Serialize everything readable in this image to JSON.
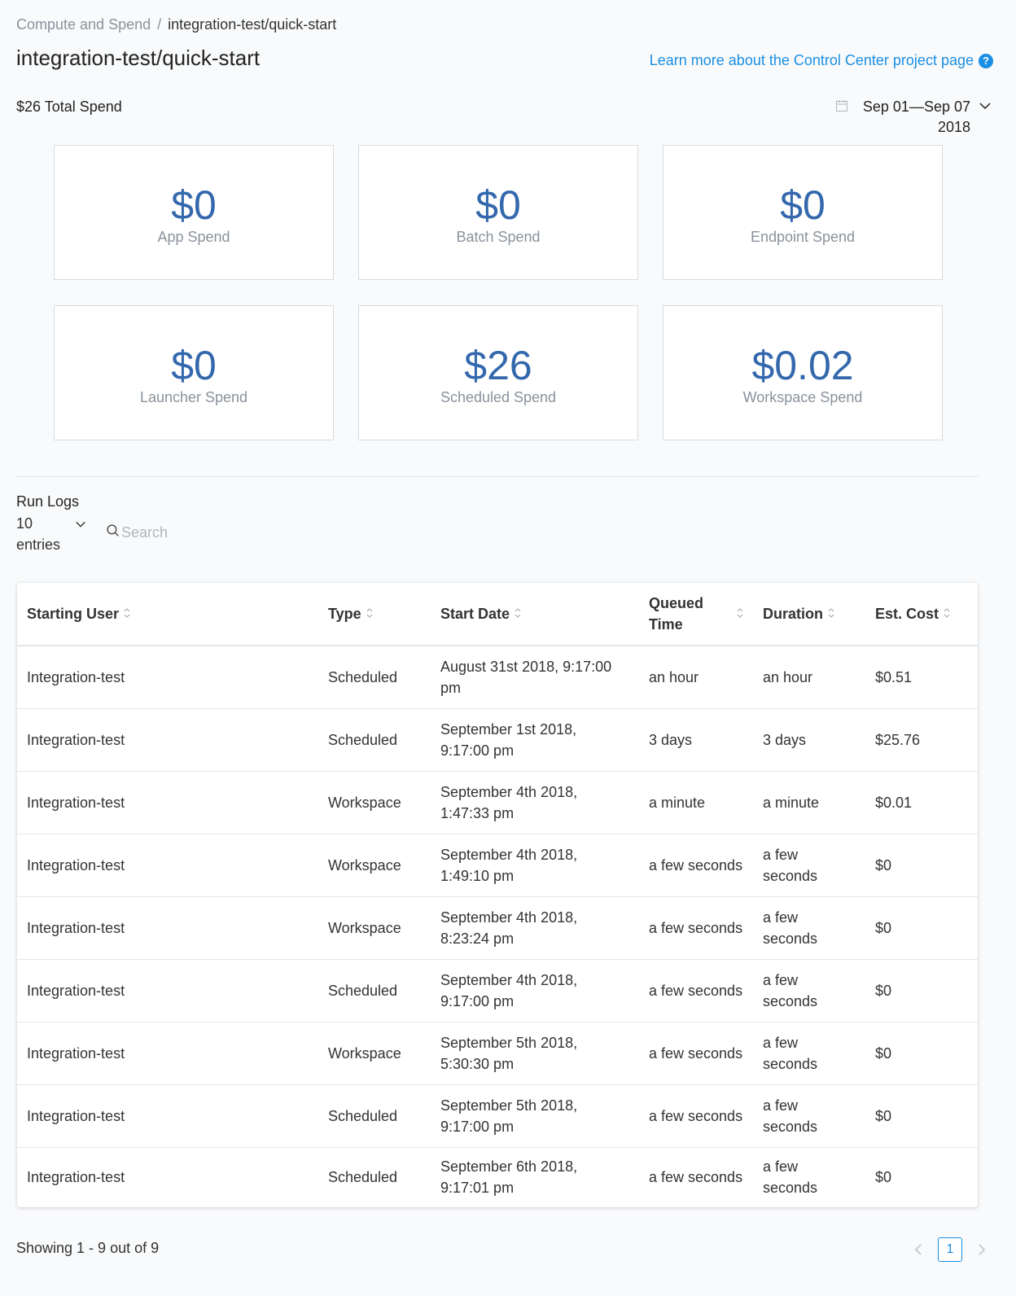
{
  "breadcrumb": {
    "parent": "Compute and Spend",
    "separator": "/",
    "current": "integration-test/quick-start"
  },
  "page_title": "integration-test/quick-start",
  "learn_more": {
    "label": "Learn more about the Control Center project page",
    "icon": "help-icon"
  },
  "total_spend": "$26 Total Spend",
  "date_range": {
    "line1": "Sep 01—Sep 07",
    "line2": "2018",
    "icon": "calendar-icon"
  },
  "cards": [
    {
      "value": "$0",
      "label": "App Spend"
    },
    {
      "value": "$0",
      "label": "Batch Spend"
    },
    {
      "value": "$0",
      "label": "Endpoint Spend"
    },
    {
      "value": "$0",
      "label": "Launcher Spend"
    },
    {
      "value": "$26",
      "label": "Scheduled Spend"
    },
    {
      "value": "$0.02",
      "label": "Workspace Spend"
    }
  ],
  "run_logs": {
    "title": "Run Logs",
    "entries_value": "10",
    "entries_label": "entries",
    "search_placeholder": "Search"
  },
  "table": {
    "headers": {
      "user": "Starting User",
      "type": "Type",
      "start": "Start Date",
      "queued": "Queued Time",
      "duration": "Duration",
      "cost": "Est. Cost"
    },
    "rows": [
      {
        "user": "Integration-test",
        "type": "Scheduled",
        "start": "August 31st 2018, 9:17:00 pm",
        "queued": "an hour",
        "duration": "an hour",
        "cost": "$0.51"
      },
      {
        "user": "Integration-test",
        "type": "Scheduled",
        "start": "September 1st 2018, 9:17:00 pm",
        "queued": "3 days",
        "duration": "3 days",
        "cost": "$25.76"
      },
      {
        "user": "Integration-test",
        "type": "Workspace",
        "start": "September 4th 2018, 1:47:33 pm",
        "queued": "a minute",
        "duration": "a minute",
        "cost": "$0.01"
      },
      {
        "user": "Integration-test",
        "type": "Workspace",
        "start": "September 4th 2018, 1:49:10 pm",
        "queued": "a few seconds",
        "duration": "a few seconds",
        "cost": "$0"
      },
      {
        "user": "Integration-test",
        "type": "Workspace",
        "start": "September 4th 2018, 8:23:24 pm",
        "queued": "a few seconds",
        "duration": "a few seconds",
        "cost": "$0"
      },
      {
        "user": "Integration-test",
        "type": "Scheduled",
        "start": "September 4th 2018, 9:17:00 pm",
        "queued": "a few seconds",
        "duration": "a few seconds",
        "cost": "$0"
      },
      {
        "user": "Integration-test",
        "type": "Workspace",
        "start": "September 5th 2018, 5:30:30 pm",
        "queued": "a few seconds",
        "duration": "a few seconds",
        "cost": "$0"
      },
      {
        "user": "Integration-test",
        "type": "Scheduled",
        "start": "September 5th 2018, 9:17:00 pm",
        "queued": "a few seconds",
        "duration": "a few seconds",
        "cost": "$0"
      },
      {
        "user": "Integration-test",
        "type": "Scheduled",
        "start": "September 6th 2018, 9:17:01 pm",
        "queued": "a few seconds",
        "duration": "a few seconds",
        "cost": "$0"
      }
    ]
  },
  "footer": {
    "showing": "Showing 1 - 9 out of 9",
    "current_page": "1"
  },
  "colors": {
    "accent": "#1a8fe3",
    "card_value": "#3468ad",
    "muted": "#8a929c"
  }
}
